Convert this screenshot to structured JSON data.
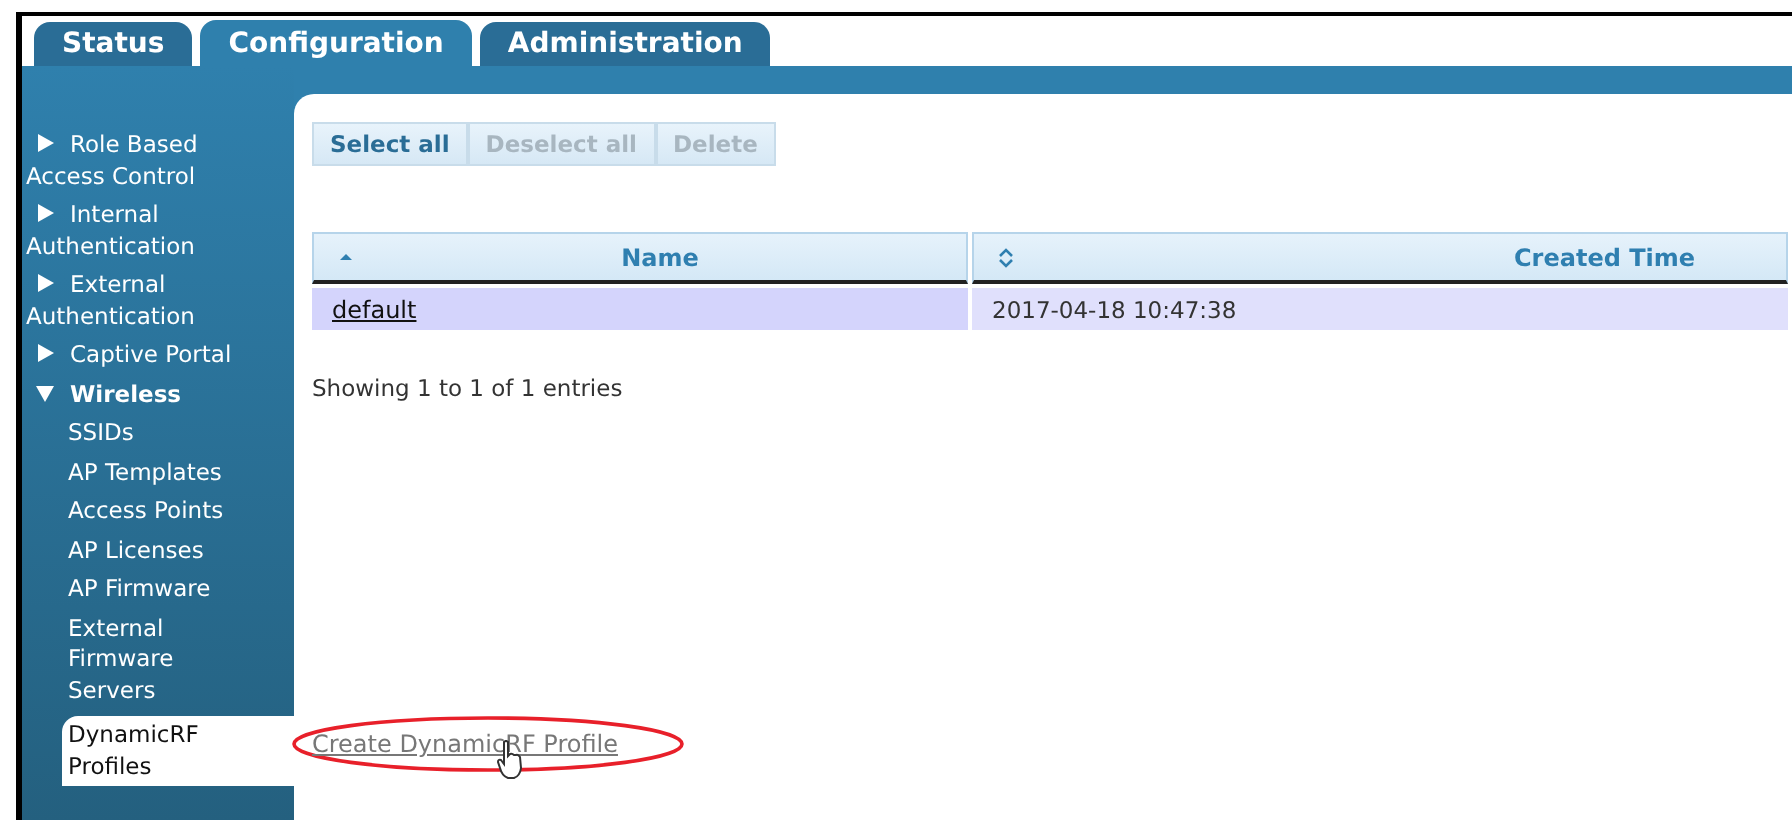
{
  "tabs": [
    {
      "label": "Status",
      "selected": false
    },
    {
      "label": "Configuration",
      "selected": true
    },
    {
      "label": "Administration",
      "selected": false
    }
  ],
  "sidebar": {
    "items": [
      {
        "label": "Role Based Access Control",
        "expanded": false,
        "selected": false
      },
      {
        "label": "Internal Authentication",
        "expanded": false,
        "selected": false
      },
      {
        "label": "External Authentication",
        "expanded": false,
        "selected": false
      },
      {
        "label": "Captive Portal",
        "expanded": false,
        "selected": false
      },
      {
        "label": "Wireless",
        "expanded": true,
        "selected": false,
        "children": [
          {
            "label": "SSIDs",
            "selected": false
          },
          {
            "label": "AP Templates",
            "selected": false
          },
          {
            "label": "Access Points",
            "selected": false
          },
          {
            "label": "AP Licenses",
            "selected": false
          },
          {
            "label": "AP Firmware",
            "selected": false
          },
          {
            "label": "External Firmware Servers",
            "selected": false
          },
          {
            "label": "DynamicRF Profiles",
            "selected": true
          }
        ]
      }
    ]
  },
  "toolbar": [
    {
      "label": "Select all",
      "disabled": false
    },
    {
      "label": "Deselect all",
      "disabled": true
    },
    {
      "label": "Delete",
      "disabled": true
    }
  ],
  "table": {
    "columns": [
      {
        "label": "Name",
        "sorted": true
      },
      {
        "label": "Created Time",
        "sorted": false
      }
    ],
    "rows": [
      {
        "selected": true,
        "cells": [
          "default",
          "2017-04-18 10:47:38"
        ]
      }
    ]
  },
  "info": "Showing 1 to 1 of 1 entries",
  "create_link": {
    "label": "Create DynamicRF Profile",
    "highlighted": true
  }
}
